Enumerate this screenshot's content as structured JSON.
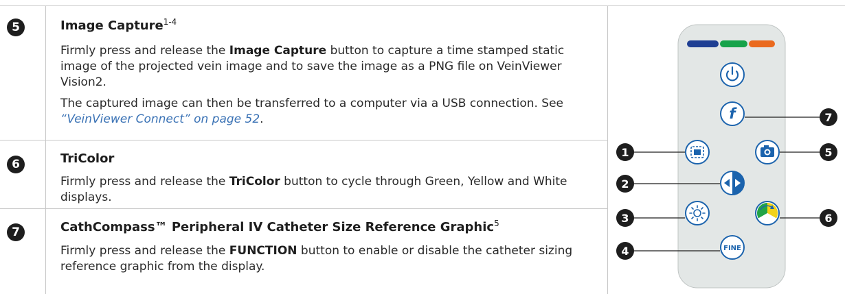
{
  "rows": [
    {
      "number": "5",
      "title": "Image Capture",
      "title_sup": "1-4",
      "para1": {
        "a": "Firmly press and release the ",
        "b": "Image Capture",
        "c": " button to capture a time stamped static image of the projected vein image and to save the image as a PNG file on VeinViewer Vision2."
      },
      "para2": {
        "a": "The captured image can then be transferred to a computer via a USB connection. See ",
        "link": "“VeinViewer Connect” on page 52",
        "c": "."
      }
    },
    {
      "number": "6",
      "title": "TriColor",
      "para1": {
        "a": "Firmly press and release the ",
        "b": "TriColor",
        "c": " button to cycle through Green, Yellow and White displays."
      }
    },
    {
      "number": "7",
      "title": "CathCompass™ Peripheral IV Catheter Size Reference Graphic",
      "title_sup": "5",
      "para1": {
        "a": "Firmly press and release the ",
        "b": "FUNCTION",
        "c": " button to enable or disable the catheter sizing reference graphic from the display."
      }
    }
  ],
  "remote": {
    "fine_label": "FINE",
    "function_label": "f",
    "callouts": [
      "1",
      "2",
      "3",
      "4",
      "5",
      "6",
      "7"
    ],
    "indicator_colors": [
      "#1f3f93",
      "#16a34a",
      "#ea6a1e"
    ],
    "button_color": "#1b63ad",
    "body_color": "#e3e7e6"
  }
}
